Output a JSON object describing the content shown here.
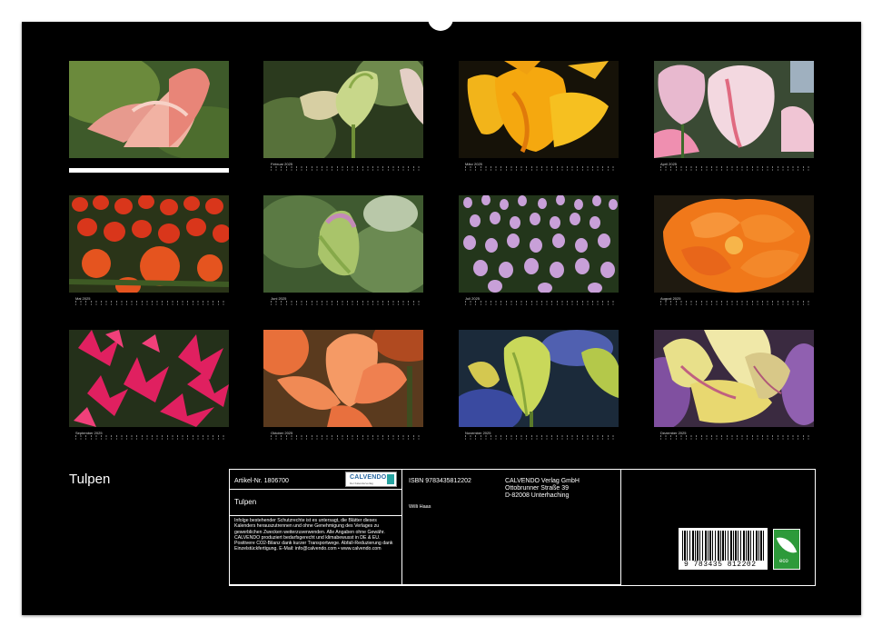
{
  "calendar": {
    "title": "Tulpen",
    "months": [
      {
        "label": ""
      },
      {
        "label": "Februar 2025"
      },
      {
        "label": "März 2025"
      },
      {
        "label": "April 2025"
      },
      {
        "label": "Mai 2025"
      },
      {
        "label": "Juni 2025"
      },
      {
        "label": "Juli 2025"
      },
      {
        "label": "August 2025"
      },
      {
        "label": "September 2025"
      },
      {
        "label": "Oktober 2025"
      },
      {
        "label": "November 2025"
      },
      {
        "label": "Dezember 2025"
      }
    ]
  },
  "info": {
    "article": "Artikel-Nr. 1806700",
    "product_title": "Tulpen",
    "isbn": "ISBN 9783435812202",
    "author": "Willi Haas",
    "publisher_lines": [
      "CALVENDO Verlag GmbH",
      "Ottobrunner Straße 39",
      "D-82008 Unterhaching"
    ],
    "legal": "Infolge bestehender Schutzrechte ist es untersagt, die Blätter dieses Kalenders herauszutrennen und ohne Genehmigung des Verlages zu gewerblichen Zwecken weiterzuverwenden. Alle Angaben ohne Gewähr. CALVENDO produziert bedarfsgerecht und klimabewusst in DE & EU. Positivere CO2-Bilanz dank kurzer Transportwege. Abfall-Reduzierung dank Einzelstückfertigung. E-Mail: info@calvendo.com • www.calvendo.com",
    "logo_text": "CALVENDO",
    "logo_tagline": "Der Kalenderverlag",
    "barcode_number": "9 783435 812202",
    "eco_label": "eco"
  },
  "colors": {
    "sheet": "#000000",
    "calvendo_blue": "#2b6aa3",
    "eco_green": "#2d9a3a"
  }
}
